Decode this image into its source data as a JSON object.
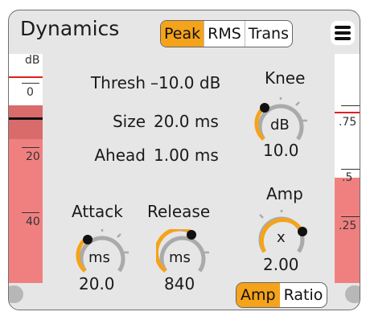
{
  "title": "Dynamics",
  "modes": [
    "Peak",
    "RMS",
    "Trans"
  ],
  "active_mode": "Peak",
  "params": {
    "thresh": {
      "label": "Thresh",
      "value": "–10.0 dB"
    },
    "size": {
      "label": "Size",
      "value": "20.0 ms"
    },
    "ahead": {
      "label": "Ahead",
      "value": "1.00 ms"
    }
  },
  "knobs": {
    "knee": {
      "label": "Knee",
      "unit": "dB",
      "value": "10.0"
    },
    "attack": {
      "label": "Attack",
      "unit": "ms",
      "value": "20.0"
    },
    "release": {
      "label": "Release",
      "unit": "ms",
      "value": "840"
    },
    "amp": {
      "label": "Amp",
      "unit": "x",
      "value": "2.00"
    }
  },
  "left_meter": {
    "unit": "dB",
    "ticks": [
      "0",
      "20",
      "40"
    ]
  },
  "right_meter": {
    "ticks": [
      ".75",
      ".5",
      ".25"
    ]
  },
  "toggle": {
    "options": [
      "Amp",
      "Ratio"
    ],
    "active": "Amp"
  },
  "colors": {
    "accent": "#f5a31a",
    "meter_fill": "#f08080",
    "meter_dark": "#d96b6b",
    "panel": "#e6e6e6"
  }
}
